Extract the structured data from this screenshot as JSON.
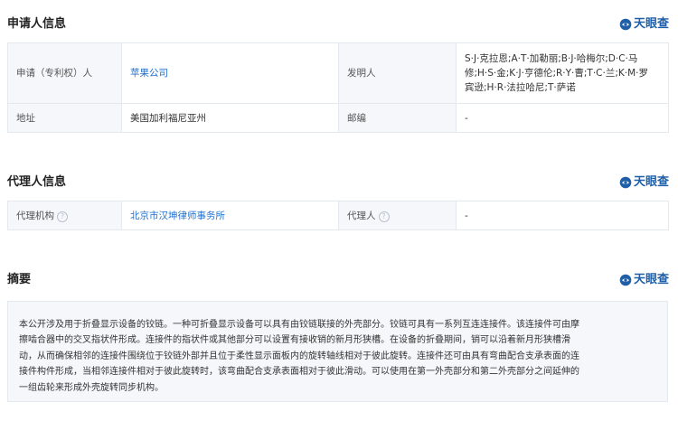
{
  "colors": {
    "brand": "#1f5fa8",
    "link": "#1f6fd0",
    "label_bg": "#f5f7fa",
    "border": "#e4e9f0"
  },
  "brand": {
    "text": "天眼查",
    "icon": "tianyancha-logo-icon"
  },
  "applicant": {
    "title": "申请人信息",
    "row1": {
      "applicant_label": "申请（专利权）人",
      "applicant_value": "苹果公司",
      "inventor_label": "发明人",
      "inventor_lines": [
        "S·J·克拉恩;A·T·加勒丽;B·J·哈梅尔;D·C·马",
        "修;H·S·金;K·J·亨德伦;R·Y·曹;T·C·兰;K·M·罗",
        "宾逊;H·R·法拉哈尼;T·萨诺"
      ]
    },
    "row2": {
      "address_label": "地址",
      "address_value": "美国加利福尼亚州",
      "postcode_label": "邮编",
      "postcode_value": "-"
    }
  },
  "agent": {
    "title": "代理人信息",
    "org_label": "代理机构",
    "org_value": "北京市汉坤律师事务所",
    "agent_label": "代理人",
    "agent_value": "-"
  },
  "abstract": {
    "title": "摘要",
    "lines": [
      "本公开涉及用于折叠显示设备的铰链。一种可折叠显示设备可以具有由铰链联接的外壳部分。铰链可具有一系列互连连接件。该连接件可由摩",
      "擦啮合器中的交叉指状件形成。连接件的指状件或其他部分可以设置有接收销的新月形狭槽。在设备的折叠期间，销可以沿着新月形狭槽滑",
      "动，从而确保相邻的连接件围绕位于铰链外部并且位于柔性显示面板内的旋转轴线相对于彼此旋转。连接件还可由具有弯曲配合支承表面的连",
      "接件构件形成，当相邻连接件相对于彼此旋转时，该弯曲配合支承表面相对于彼此滑动。可以使用在第一外壳部分和第二外壳部分之间延伸的",
      "一组齿轮来形成外壳旋转同步机构。"
    ]
  }
}
